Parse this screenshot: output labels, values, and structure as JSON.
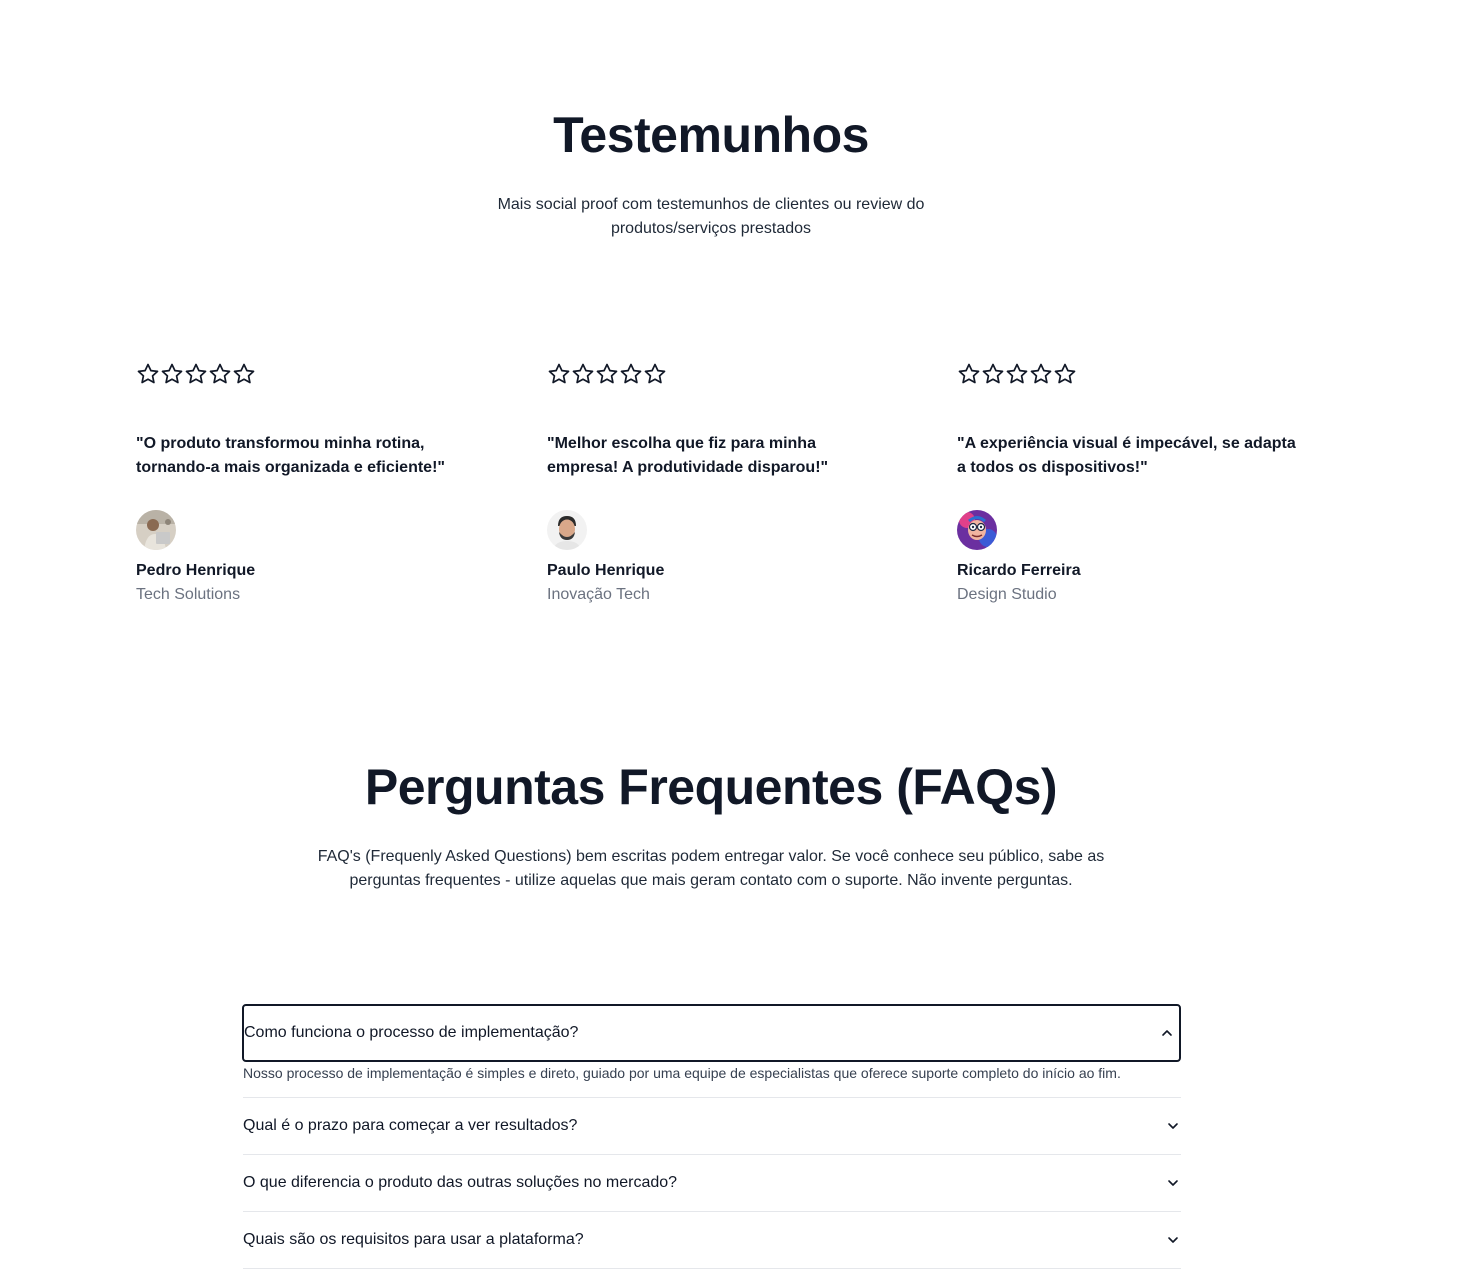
{
  "testimonials": {
    "title": "Testemunhos",
    "subtitle_line1": "Mais social proof com testemunhos de clientes ou review do",
    "subtitle_line2": "produtos/serviços prestados",
    "rating_outline_stars": 5,
    "star_color": "#111827",
    "items": [
      {
        "quote": "\"O produto transformou minha rotina, tornando-a mais organizada e eficiente!\"",
        "name": "Pedro Henrique",
        "company": "Tech Solutions"
      },
      {
        "quote": "\"Melhor escolha que fiz para minha empresa! A produtividade disparou!\"",
        "name": "Paulo Henrique",
        "company": "Inovação Tech"
      },
      {
        "quote": "\"A experiência visual é impecável, se adapta a todos os dispositivos!\"",
        "name": "Ricardo Ferreira",
        "company": "Design Studio"
      }
    ]
  },
  "faq": {
    "title": "Perguntas Frequentes (FAQs)",
    "subtitle_line1": "FAQ's (Frequenly Asked Questions) bem escritas podem entregar valor. Se você conhece seu público, sabe as",
    "subtitle_line2": "perguntas frequentes - utilize aquelas que mais geram contato com o suporte. Não invente perguntas.",
    "open_item": {
      "question": "Como funciona o processo de implementação?",
      "answer": "Nosso processo de implementação é simples e direto, guiado por uma equipe de especialistas que oferece suporte completo do início ao fim."
    },
    "items": [
      {
        "question": "Qual é o prazo para começar a ver resultados?"
      },
      {
        "question": "O que diferencia o produto das outras soluções no mercado?"
      },
      {
        "question": "Quais são os requisitos para usar a plataforma?"
      }
    ]
  }
}
